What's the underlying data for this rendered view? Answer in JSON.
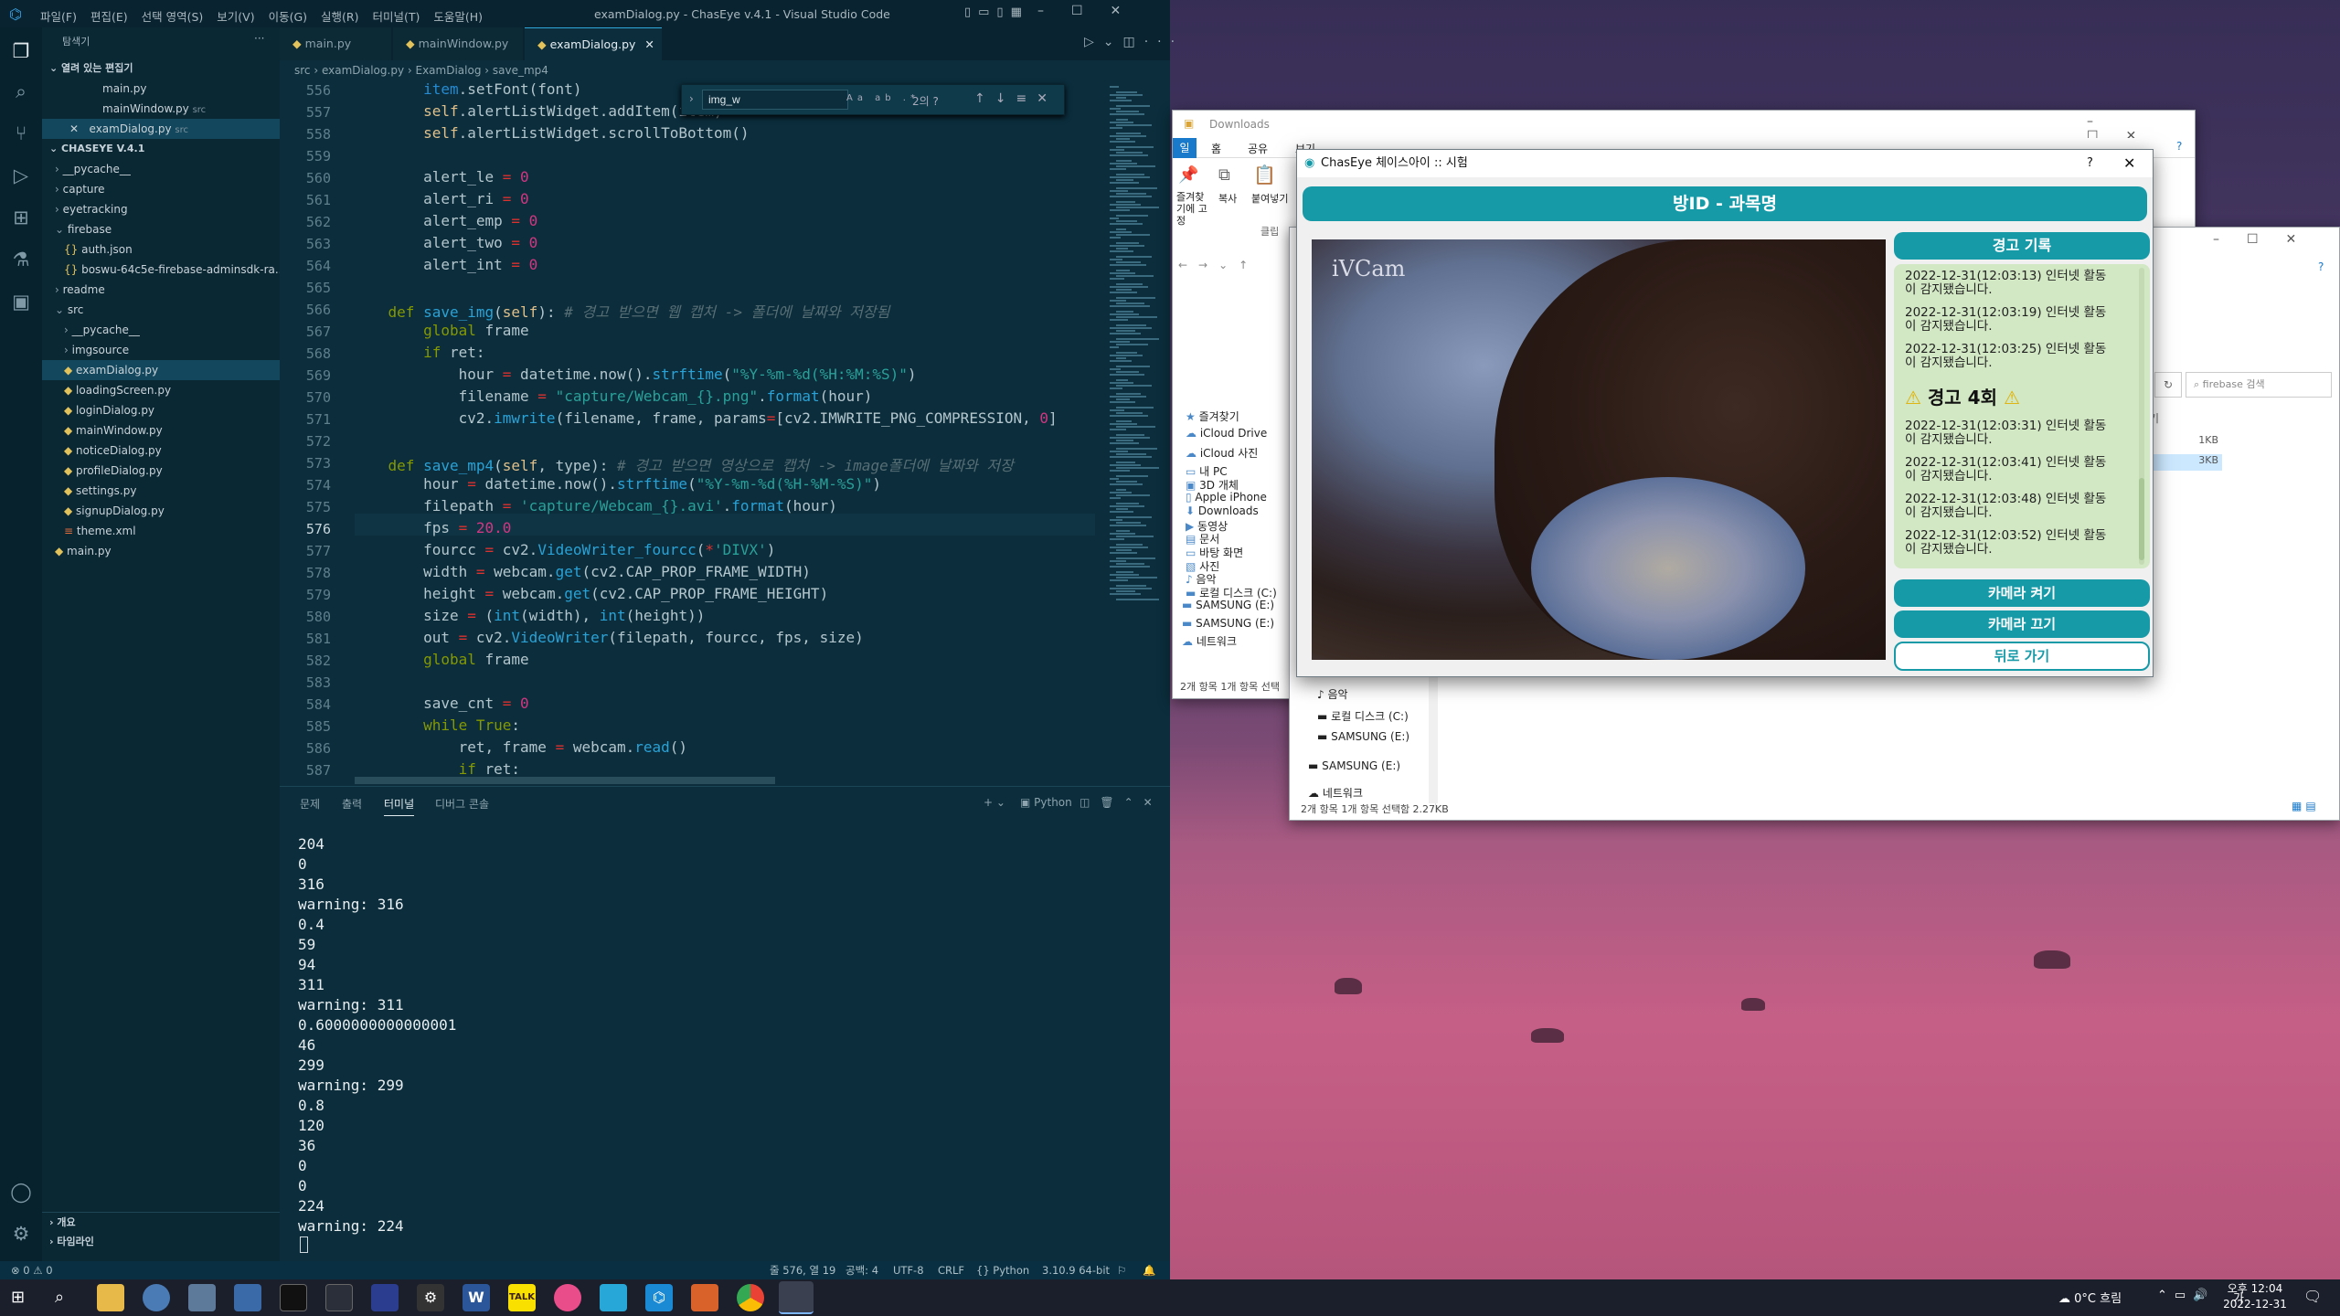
{
  "vscode": {
    "title": "examDialog.py - ChasEye v.4.1 - Visual Studio Code",
    "menu": [
      "파일(F)",
      "편집(E)",
      "선택 영역(S)",
      "보기(V)",
      "이동(G)",
      "실행(R)",
      "터미널(T)",
      "도움말(H)"
    ],
    "sidebar": {
      "title": "탐색기",
      "open_editors": "열려 있는 편집기",
      "open_files": [
        {
          "name": "main.py",
          "path": ""
        },
        {
          "name": "mainWindow.py",
          "path": "src"
        },
        {
          "name": "examDialog.py",
          "path": "src"
        }
      ],
      "project": "CHASEYE V.4.1",
      "items": [
        "__pycache__",
        "capture",
        "eyetracking",
        "firebase",
        "auth.json",
        "boswu-64c5e-firebase-adminsdk-ra...",
        "readme",
        "src",
        "__pycache__",
        "imgsource",
        "examDialog.py",
        "loadingScreen.py",
        "loginDialog.py",
        "mainWindow.py",
        "noticeDialog.py",
        "profileDialog.py",
        "settings.py",
        "signupDialog.py",
        "theme.xml",
        "main.py"
      ],
      "outline": "개요",
      "timeline": "타임라인"
    },
    "tabs": [
      "main.py",
      "mainWindow.py",
      "examDialog.py"
    ],
    "breadcrumb": [
      "src",
      "examDialog.py",
      "ExamDialog",
      "save_mp4"
    ],
    "find": {
      "query": "img_w",
      "count": "2의 ?"
    },
    "line_numbers": [
      "556",
      "557",
      "558",
      "559",
      "560",
      "561",
      "562",
      "563",
      "564",
      "565",
      "566",
      "567",
      "568",
      "569",
      "570",
      "571",
      "572",
      "573",
      "574",
      "575",
      "576",
      "577",
      "578",
      "579",
      "580",
      "581",
      "582",
      "583",
      "584",
      "585",
      "586",
      "587"
    ],
    "panel_tabs": [
      "문제",
      "출력",
      "터미널",
      "디버그 콘솔"
    ],
    "panel_lang": "Python",
    "terminal": [
      "204",
      "0",
      "316",
      "warning: 316",
      "0.4",
      "59",
      "94",
      "311",
      "warning: 311",
      "0.6000000000000001",
      "46",
      "299",
      "warning: 299",
      "0.8",
      "120",
      "36",
      "0",
      "0",
      "224",
      "warning: 224"
    ],
    "status": {
      "errors": "⊗ 0  ⚠ 0",
      "position": "줄 576, 열 19",
      "spaces": "공백: 4",
      "encoding": "UTF-8",
      "eol": "CRLF",
      "lang": "Python",
      "version": "3.10.9 64-bit"
    }
  },
  "explorer_back": {
    "path": "Downloads",
    "tabs": [
      "일",
      "홈",
      "공유",
      "보기"
    ],
    "ribbon": [
      "즐겨찾기에 고정",
      "복사",
      "붙여넣기"
    ],
    "ribbon_group": "클립",
    "nav": [
      "즐겨찾기",
      "iCloud Drive",
      "iCloud 사진",
      "내 PC",
      "3D 개체",
      "Apple iPhone",
      "Downloads",
      "동영상",
      "문서",
      "바탕 화면",
      "사진",
      "음악",
      "로컬 디스크 (C:)",
      "SAMSUNG (E:)",
      "SAMSUNG (E:)",
      "네트워크"
    ],
    "status": "2개 항목   1개 항목 선택"
  },
  "explorer_front": {
    "search": "firebase 검색",
    "sizes": [
      "1KB",
      "3KB"
    ],
    "nav": [
      "음악",
      "로컬 디스크 (C:)",
      "SAMSUNG (E:)",
      "SAMSUNG (E:)",
      "네트워크"
    ],
    "status": "2개 항목     1개 항목 선택함 2.27KB",
    "col_hint": "기"
  },
  "chaseye": {
    "window_title": "ChasEye 체이스아이 :: 시험",
    "header": "방ID - 과목명",
    "camera_watermark": "iVCam",
    "alerts_header": "경고 기록",
    "alerts_before": [
      "2022-12-31(12:03:13) 인터넷 활동이 감지됐습니다.",
      "2022-12-31(12:03:19) 인터넷 활동이 감지됐습니다.",
      "2022-12-31(12:03:25) 인터넷 활동이 감지됐습니다."
    ],
    "warning_count": "경고 4회",
    "alerts_after": [
      "2022-12-31(12:03:31) 인터넷 활동이 감지됐습니다.",
      "2022-12-31(12:03:41) 인터넷 활동이 감지됐습니다.",
      "2022-12-31(12:03:48) 인터넷 활동이 감지됐습니다.",
      "2022-12-31(12:03:52) 인터넷 활동이 감지됐습니다."
    ],
    "btn_cam_on": "카메라 켜기",
    "btn_cam_off": "카메라 끄기",
    "btn_back": "뒤로 가기",
    "teal": "#179aa8"
  },
  "taskbar": {
    "weather": "0°C  흐림",
    "time": "오후 12:04",
    "date": "2022-12-31",
    "ime": "가"
  }
}
